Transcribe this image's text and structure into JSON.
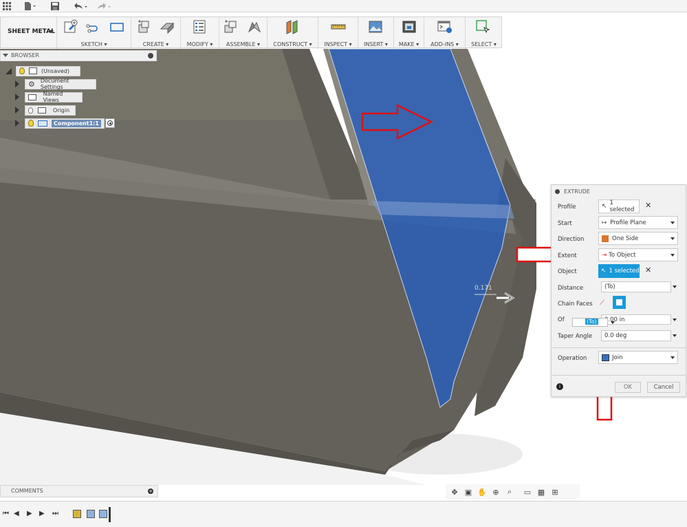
{
  "toolbar": {
    "workspace": "SHEET METAL",
    "groups": {
      "sketch": "SKETCH",
      "create": "CREATE",
      "modify": "MODIFY",
      "assemble": "ASSEMBLE",
      "construct": "CONSTRUCT",
      "inspect": "INSPECT",
      "insert": "INSERT",
      "make": "MAKE",
      "addins": "ADD-INS",
      "select": "SELECT"
    }
  },
  "browser": {
    "title": "BROWSER",
    "root": "(Unsaved)",
    "items": [
      "Document Settings",
      "Named Views",
      "Origin",
      "Component1:1"
    ]
  },
  "viewport": {
    "dimension": "0.171"
  },
  "extrude": {
    "title": "EXTRUDE",
    "profile_label": "Profile",
    "profile_value": "1 selected",
    "start_label": "Start",
    "start_value": "Profile Plane",
    "direction_label": "Direction",
    "direction_value": "One Side",
    "extent_label": "Extent",
    "extent_value": "To Object",
    "object_label": "Object",
    "object_value": "1 selected",
    "distance_label": "Distance",
    "distance_value": "(To)",
    "chain_label": "Chain Faces",
    "offset_label": "Of",
    "offset_value": "0.00 in",
    "offset_tooltip": "(To)",
    "taper_label": "Taper Angle",
    "taper_value": "0.0 deg",
    "operation_label": "Operation",
    "operation_value": "Join",
    "ok": "OK",
    "cancel": "Cancel"
  },
  "comments": {
    "title": "COMMENTS"
  },
  "colors": {
    "accent_blue": "#1a9ad9",
    "annotation_red": "#e01010",
    "body_grey": "#6e6a62",
    "selection_blue": "#2a5fb8"
  }
}
